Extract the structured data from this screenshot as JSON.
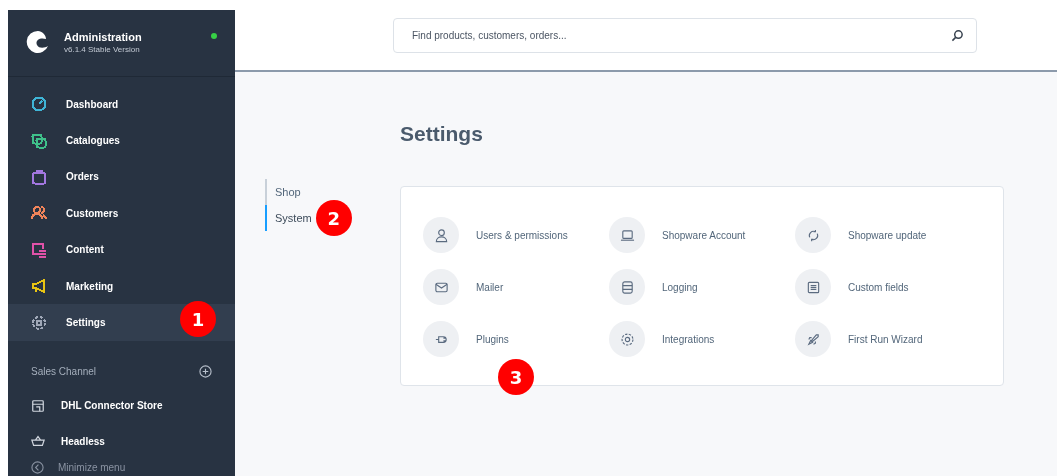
{
  "sidebar": {
    "title": "Administration",
    "version": "v6.1.4 Stable Version",
    "online": true,
    "items": [
      {
        "label": "Dashboard",
        "color": "#3fb5d7",
        "selected": false
      },
      {
        "label": "Catalogues",
        "color": "#3fc18a",
        "selected": false
      },
      {
        "label": "Orders",
        "color": "#a377e0",
        "selected": false
      },
      {
        "label": "Customers",
        "color": "#f0845a",
        "selected": false
      },
      {
        "label": "Content",
        "color": "#e052a8",
        "selected": false
      },
      {
        "label": "Marketing",
        "color": "#e8c413",
        "selected": false
      },
      {
        "label": "Settings",
        "color": "#a0a8b8",
        "selected": true,
        "callout": "1"
      }
    ],
    "sales_channel": {
      "heading": "Sales Channel",
      "channels": [
        {
          "label": "DHL Connector Store"
        },
        {
          "label": "Headless"
        }
      ]
    },
    "minimize": "Minimize menu"
  },
  "search": {
    "placeholder": "Find products, customers, orders..."
  },
  "page": {
    "title": "Settings",
    "tabs": [
      {
        "label": "Shop",
        "selected": false
      },
      {
        "label": "System",
        "selected": true,
        "callout": "2"
      }
    ],
    "modules": [
      {
        "label": "Users & permissions"
      },
      {
        "label": "Shopware Account"
      },
      {
        "label": "Shopware update"
      },
      {
        "label": "Mailer"
      },
      {
        "label": "Logging"
      },
      {
        "label": "Custom fields"
      },
      {
        "label": "Plugins",
        "callout": "3"
      },
      {
        "label": "Integrations"
      },
      {
        "label": "First Run Wizard"
      }
    ]
  }
}
